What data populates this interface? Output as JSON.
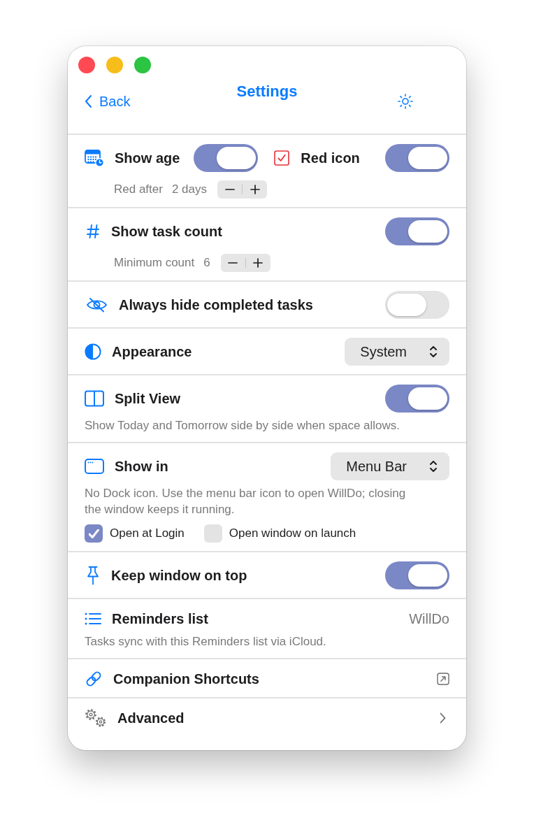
{
  "nav": {
    "back_label": "Back",
    "title": "Settings"
  },
  "rows": [
    {
      "kind": "toggle",
      "label": "Show age",
      "on": true,
      "extra": {
        "label": "Red icon",
        "on": true
      },
      "stepper": {
        "label": "Red after",
        "value": "2 days"
      }
    },
    {
      "kind": "toggle",
      "label": "Show task count",
      "on": true,
      "stepper": {
        "label": "Minimum count",
        "value": "6"
      }
    },
    {
      "kind": "toggle",
      "label": "Always hide completed tasks",
      "on": false
    },
    {
      "kind": "popup",
      "label": "Appearance",
      "value": "System"
    },
    {
      "kind": "toggle",
      "label": "Split View",
      "on": true,
      "description": "Show Today and Tomorrow side by side when space allows."
    },
    {
      "kind": "popup",
      "label": "Show in",
      "value": "Menu Bar",
      "description": "No Dock icon. Use the menu bar icon to open WillDo; closing the window keeps it running.",
      "options": [
        {
          "label": "Open at Login",
          "checked": true
        },
        {
          "label": "Open window on launch",
          "checked": false
        }
      ]
    },
    {
      "kind": "toggle",
      "label": "Keep window on top",
      "on": true
    },
    {
      "kind": "value",
      "label": "Reminders list",
      "value": "WillDo",
      "description": "Tasks sync with this Reminders list via iCloud."
    },
    {
      "kind": "link",
      "label": "Companion Shortcuts"
    },
    {
      "kind": "nav",
      "label": "Advanced"
    }
  ]
}
